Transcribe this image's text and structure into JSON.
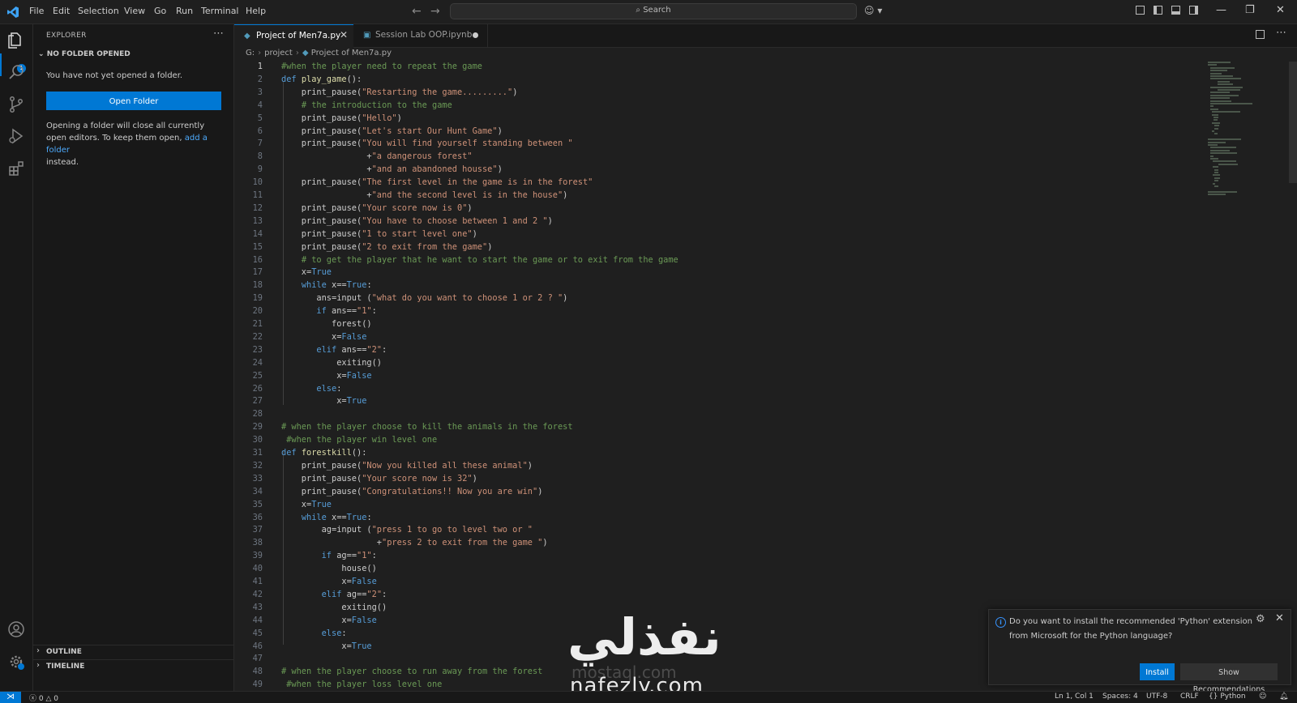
{
  "menu": [
    "File",
    "Edit",
    "Selection",
    "View",
    "Go",
    "Run",
    "Terminal",
    "Help"
  ],
  "search": {
    "label": "Search"
  },
  "sidebar": {
    "title": "EXPLORER",
    "section_title": "NO FOLDER OPENED",
    "message": "You have not yet opened a folder.",
    "open_folder_button": "Open Folder",
    "closing_text_1": "Opening a folder will close all currently open editors. To keep them open, ",
    "closing_link": "add a folder",
    "closing_text_2": "instead.",
    "outline": "OUTLINE",
    "timeline": "TIMELINE"
  },
  "tabs": [
    {
      "label": "Project of Men7a.py",
      "active": true
    },
    {
      "label": "Session Lab OOP.ipynb",
      "active": false,
      "dirty": true
    }
  ],
  "breadcrumb": [
    "G:",
    "project",
    "Project of Men7a.py"
  ],
  "code_lines": [
    [
      [
        "cm",
        "#when the player need to repeat the game"
      ]
    ],
    [
      [
        "kw",
        "def "
      ],
      [
        "fn",
        "play_game"
      ],
      [
        "",
        "():"
      ]
    ],
    [
      [
        "",
        "    print_pause("
      ],
      [
        "st",
        "\"Restarting the game.........\""
      ],
      [
        "",
        ")"
      ]
    ],
    [
      [
        "",
        "    "
      ],
      [
        "cm",
        "# the introduction to the game"
      ]
    ],
    [
      [
        "",
        "    print_pause("
      ],
      [
        "st",
        "\"Hello\""
      ],
      [
        "",
        ")"
      ]
    ],
    [
      [
        "",
        "    print_pause("
      ],
      [
        "st",
        "\"Let's start Our Hunt Game\""
      ],
      [
        "",
        ")"
      ]
    ],
    [
      [
        "",
        "    print_pause("
      ],
      [
        "st",
        "\"You will find yourself standing between \""
      ]
    ],
    [
      [
        "",
        "                 +"
      ],
      [
        "st",
        "\"a dangerous forest\""
      ]
    ],
    [
      [
        "",
        "                 +"
      ],
      [
        "st",
        "\"and an abandoned housse\""
      ],
      [
        "",
        ")"
      ]
    ],
    [
      [
        "",
        "    print_pause("
      ],
      [
        "st",
        "\"The first level in the game is in the forest\""
      ]
    ],
    [
      [
        "",
        "                 +"
      ],
      [
        "st",
        "\"and the second level is in the house\""
      ],
      [
        "",
        ")"
      ]
    ],
    [
      [
        "",
        "    print_pause("
      ],
      [
        "st",
        "\"Your score now is 0\""
      ],
      [
        "",
        ")"
      ]
    ],
    [
      [
        "",
        "    print_pause("
      ],
      [
        "st",
        "\"You have to choose between 1 and 2 \""
      ],
      [
        "",
        ")"
      ]
    ],
    [
      [
        "",
        "    print_pause("
      ],
      [
        "st",
        "\"1 to start level one\""
      ],
      [
        "",
        ")"
      ]
    ],
    [
      [
        "",
        "    print_pause("
      ],
      [
        "st",
        "\"2 to exit from the game\""
      ],
      [
        "",
        ")"
      ]
    ],
    [
      [
        "",
        "    "
      ],
      [
        "cm",
        "# to get the player that he want to start the game or to exit from the game"
      ]
    ],
    [
      [
        "",
        "    x="
      ],
      [
        "bl",
        "True"
      ]
    ],
    [
      [
        "",
        "    "
      ],
      [
        "kw",
        "while "
      ],
      [
        "",
        "x=="
      ],
      [
        "bl",
        "True"
      ],
      [
        "",
        ":"
      ]
    ],
    [
      [
        "",
        "       ans=input ("
      ],
      [
        "st",
        "\"what do you want to choose 1 or 2 ? \""
      ],
      [
        "",
        ")"
      ]
    ],
    [
      [
        "",
        "       "
      ],
      [
        "kw",
        "if "
      ],
      [
        "",
        "ans=="
      ],
      [
        "st",
        "\"1\""
      ],
      [
        "",
        ":"
      ]
    ],
    [
      [
        "",
        "          forest()"
      ]
    ],
    [
      [
        "",
        "          x="
      ],
      [
        "bl",
        "False"
      ]
    ],
    [
      [
        "",
        "       "
      ],
      [
        "kw",
        "elif "
      ],
      [
        "",
        "ans=="
      ],
      [
        "st",
        "\"2\""
      ],
      [
        "",
        ":"
      ]
    ],
    [
      [
        "",
        "           exiting()"
      ]
    ],
    [
      [
        "",
        "           x="
      ],
      [
        "bl",
        "False"
      ]
    ],
    [
      [
        "",
        "       "
      ],
      [
        "kw",
        "else"
      ],
      [
        "",
        ":"
      ]
    ],
    [
      [
        "",
        "           x="
      ],
      [
        "bl",
        "True"
      ]
    ],
    [],
    [
      [
        "cm",
        "# when the player choose to kill the animals in the forest"
      ]
    ],
    [
      [
        "cm",
        " #when the player win level one"
      ]
    ],
    [
      [
        "kw",
        "def "
      ],
      [
        "fn",
        "forestkill"
      ],
      [
        "",
        "():"
      ]
    ],
    [
      [
        "",
        "    print_pause("
      ],
      [
        "st",
        "\"Now you killed all these animal\""
      ],
      [
        "",
        ")"
      ]
    ],
    [
      [
        "",
        "    print_pause("
      ],
      [
        "st",
        "\"Your score now is 32\""
      ],
      [
        "",
        ")"
      ]
    ],
    [
      [
        "",
        "    print_pause("
      ],
      [
        "st",
        "\"Congratulations!! Now you are win\""
      ],
      [
        "",
        ")"
      ]
    ],
    [
      [
        "",
        "    x="
      ],
      [
        "bl",
        "True"
      ]
    ],
    [
      [
        "",
        "    "
      ],
      [
        "kw",
        "while "
      ],
      [
        "",
        "x=="
      ],
      [
        "bl",
        "True"
      ],
      [
        "",
        ":"
      ]
    ],
    [
      [
        "",
        "        ag=input ("
      ],
      [
        "st",
        "\"press 1 to go to level two or \""
      ]
    ],
    [
      [
        "",
        "                   +"
      ],
      [
        "st",
        "\"press 2 to exit from the game \""
      ],
      [
        "",
        ")"
      ]
    ],
    [
      [
        "",
        "        "
      ],
      [
        "kw",
        "if "
      ],
      [
        "",
        "ag=="
      ],
      [
        "st",
        "\"1\""
      ],
      [
        "",
        ":"
      ]
    ],
    [
      [
        "",
        "            house()"
      ]
    ],
    [
      [
        "",
        "            x="
      ],
      [
        "bl",
        "False"
      ]
    ],
    [
      [
        "",
        "        "
      ],
      [
        "kw",
        "elif "
      ],
      [
        "",
        "ag=="
      ],
      [
        "st",
        "\"2\""
      ],
      [
        "",
        ":"
      ]
    ],
    [
      [
        "",
        "            exiting()"
      ]
    ],
    [
      [
        "",
        "            x="
      ],
      [
        "bl",
        "False"
      ]
    ],
    [
      [
        "",
        "        "
      ],
      [
        "kw",
        "else"
      ],
      [
        "",
        ":"
      ]
    ],
    [
      [
        "",
        "            x="
      ],
      [
        "bl",
        "True"
      ]
    ],
    [],
    [
      [
        "cm",
        "# when the player choose to run away from the forest"
      ]
    ],
    [
      [
        "cm",
        " #when the player loss level one"
      ]
    ]
  ],
  "notification": {
    "text": "Do you want to install the recommended 'Python' extension from Microsoft for the Python language?",
    "install": "Install",
    "show_recommendations": "Show Recommendations"
  },
  "watermark": {
    "arabic": "نفذلي",
    "latin": "nafezly.com",
    "faint": "mostaql.com"
  },
  "status": {
    "errors": "0",
    "warnings": "0",
    "cursor": "Ln 1, Col 1",
    "spaces": "Spaces: 4",
    "encoding": "UTF-8",
    "eol": "CRLF",
    "language": "Python"
  },
  "colors": {
    "accent": "#0078d4",
    "keyword": "#569cd6",
    "comment": "#6a9955",
    "string": "#ce9178",
    "function": "#dcdcaa"
  }
}
